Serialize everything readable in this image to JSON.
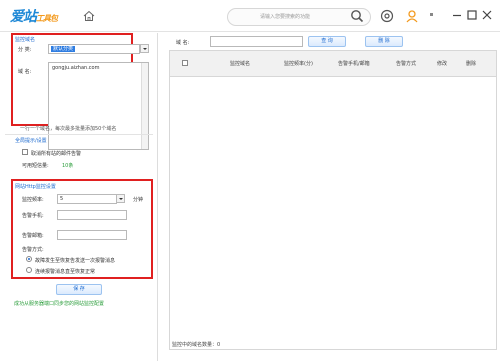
{
  "titlebar": {
    "logo_main": "爱站",
    "logo_sub": "工具包",
    "search_placeholder": "请输入您要搜索的功能"
  },
  "left": {
    "monitor_section": "监控域名",
    "category_label": "分    类:",
    "category_value": "默认分类",
    "domain_label": "域    名:",
    "domain_value": "gongju.aizhan.com",
    "domain_hint": "一行一个域名，每次最多批量添加50个域名",
    "global_section": "全局提示/设置",
    "cancel_all_label": "取消所有站的邮件告警",
    "sms_label": "可用短信量:",
    "sms_value": "10条",
    "http_section": "网站Http监控设置",
    "freq_label": "监控频率:",
    "freq_value": "5",
    "freq_unit": "分钟",
    "phone_label": "告警手机:",
    "email_label": "告警邮箱:",
    "mode_label": "告警方式:",
    "mode_option1": "故障发生至恢复告发送一次报警消息",
    "mode_option2": "连续报警消息直至恢复正常",
    "save_button": "保  存",
    "success_note": "成功从服务器端口同步您的网站监控配置"
  },
  "right": {
    "domain_label": "域  名:",
    "query_button": "查  询",
    "delete_button": "删  除",
    "columns": [
      "监控域名",
      "监控频率(分)",
      "告警手机/邮箱",
      "告警方式",
      "修改",
      "删除"
    ],
    "footer": "监控中的域名数量：0"
  },
  "colors": {
    "accent": "#1e6bd0",
    "highlight": "#e02020",
    "success": "#2a9d3a"
  }
}
